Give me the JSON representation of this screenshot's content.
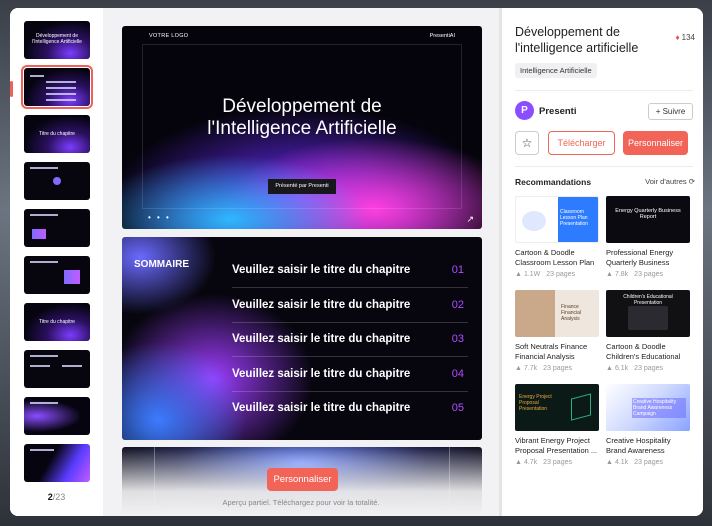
{
  "thumbnails": {
    "selected_index": 1,
    "items": [
      {
        "title": "Développement de l'Intelligence Artificielle"
      },
      {
        "title": ""
      },
      {
        "title": "Titre du chapitre"
      },
      {
        "title": ""
      },
      {
        "title": ""
      },
      {
        "title": ""
      },
      {
        "title": "Titre du chapitre"
      },
      {
        "title": ""
      },
      {
        "title": ""
      },
      {
        "title": ""
      }
    ],
    "page_current": "2",
    "page_total": "/23"
  },
  "preview": {
    "slide1": {
      "logo": "VOTRE LOGO",
      "brand": "PresentiAI",
      "title_line1": "Développement de",
      "title_line2": "l'Intelligence Artificielle",
      "pill": "Présenté par Presenti",
      "dots": "• • •",
      "arrow": "↗"
    },
    "slide2": {
      "heading": "SOMMAIRE",
      "rows": [
        {
          "text": "Veuillez saisir le titre du chapitre",
          "num": "01"
        },
        {
          "text": "Veuillez saisir le titre du chapitre",
          "num": "02"
        },
        {
          "text": "Veuillez saisir le titre du chapitre",
          "num": "03"
        },
        {
          "text": "Veuillez saisir le titre du chapitre",
          "num": "04"
        },
        {
          "text": "Veuillez saisir le titre du chapitre",
          "num": "05"
        }
      ]
    },
    "cta_label": "Personnaliser",
    "note": "Aperçu partiel. Téléchargez pour voir la totalité."
  },
  "panel": {
    "title": "Développement de l'intelligence artificielle",
    "likes": "134",
    "tag": "Intelligence Artificielle",
    "author_initial": "P",
    "author": "Presenti",
    "follow_label": "+ Suivre",
    "star_icon": "☆",
    "download_label": "Télécharger",
    "personalize_label": "Personnaliser",
    "recommendations_heading": "Recommandations",
    "see_more_label": "Voir d'autres ⟳",
    "cards": [
      {
        "name": "Cartoon & Doodle Classroom Lesson Plan Pre...",
        "likes": "1.1W",
        "pages": "23 pages",
        "img_text": "Classroom Lesson Plan Presentation",
        "bg": "#ffffff",
        "accent": "#2d7bff"
      },
      {
        "name": "Professional Energy Quarterly Business Repor...",
        "likes": "7.8k",
        "pages": "23 pages",
        "img_text": "Energy Quarterly Business Report",
        "bg": "#0a0a10",
        "accent": "#ffffff"
      },
      {
        "name": "Soft Neutrals Finance Financial Analysis Prese...",
        "likes": "7.7k",
        "pages": "23 pages",
        "img_text": "Finance Financial Analysis",
        "bg": "#efe7dd",
        "accent": "#8a6a4a"
      },
      {
        "name": "Cartoon & Doodle Children's Educational Prese...",
        "likes": "6.1k",
        "pages": "23 pages",
        "img_text": "Children's Educational Presentation",
        "bg": "#111114",
        "accent": "#ffffff"
      },
      {
        "name": "Vibrant Energy Project Proposal Presentation ...",
        "likes": "4.7k",
        "pages": "23 pages",
        "img_text": "Energy Project Proposal Presentation",
        "bg": "#0b1a16",
        "accent": "#e7a93a"
      },
      {
        "name": "Creative Hospitality Brand Awareness Campai...",
        "likes": "4.1k",
        "pages": "23 pages",
        "img_text": "Creative Hospitality Brand Awareness Campaign",
        "bg": "#cdd8ff",
        "accent": "#ffffff"
      }
    ]
  }
}
